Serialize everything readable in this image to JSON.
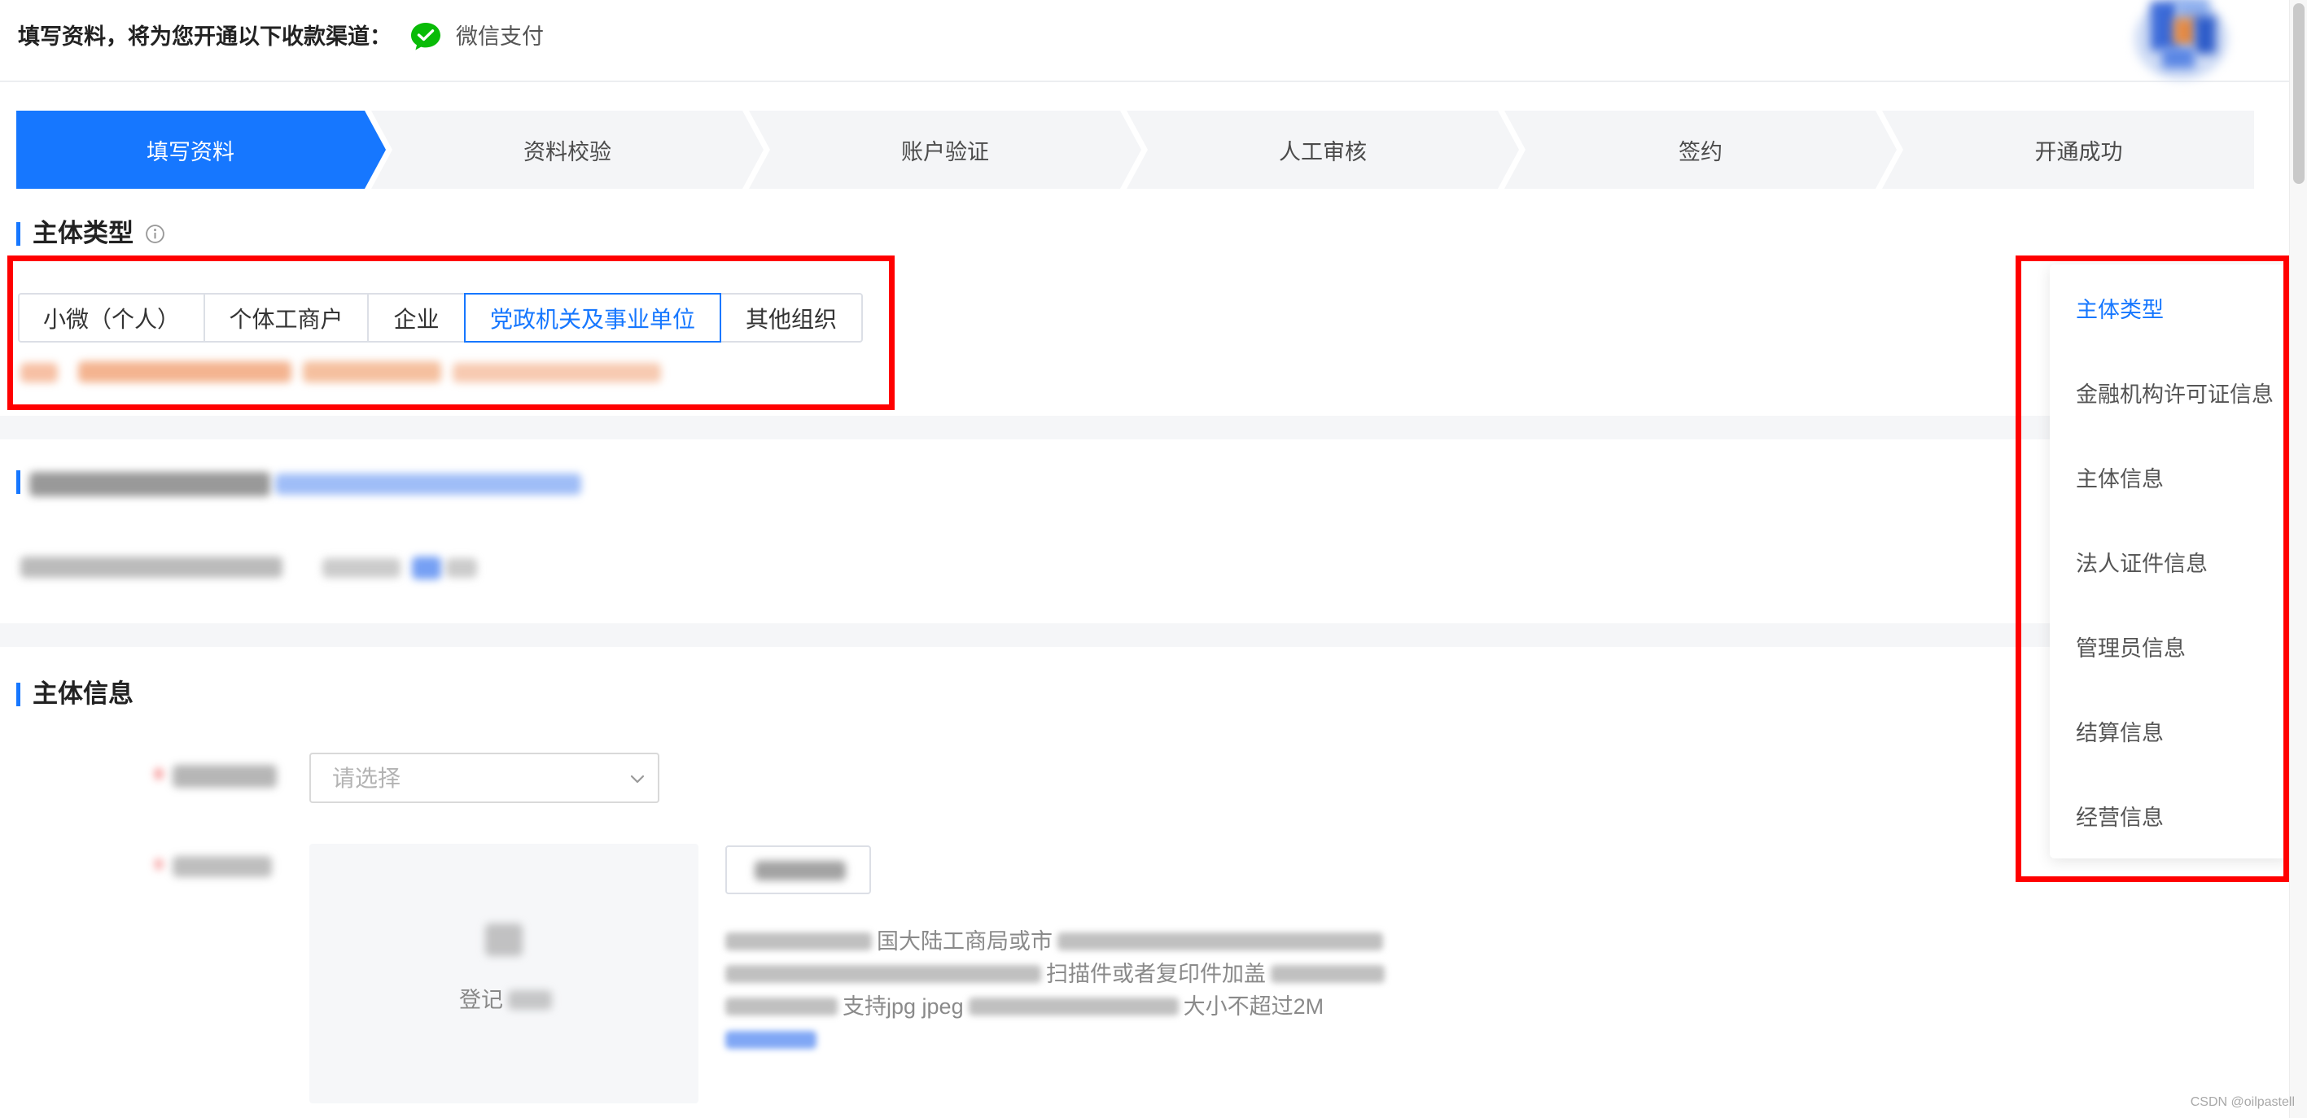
{
  "header": {
    "title": "填写资料，将为您开通以下收款渠道：",
    "channel": {
      "icon": "wechat-pay-icon",
      "label": "微信支付",
      "color": "#09bb07"
    }
  },
  "steps": [
    {
      "label": "填写资料",
      "active": true
    },
    {
      "label": "资料校验",
      "active": false
    },
    {
      "label": "账户验证",
      "active": false
    },
    {
      "label": "人工审核",
      "active": false
    },
    {
      "label": "签约",
      "active": false
    },
    {
      "label": "开通成功",
      "active": false
    }
  ],
  "subject_type": {
    "title": "主体类型",
    "info_icon": "info-icon",
    "options": [
      {
        "label": "小微（个人）",
        "selected": false
      },
      {
        "label": "个体工商户",
        "selected": false
      },
      {
        "label": "企业",
        "selected": false
      },
      {
        "label": "党政机关及事业单位",
        "selected": true
      },
      {
        "label": "其他组织",
        "selected": false
      }
    ]
  },
  "subject_info": {
    "title": "主体信息",
    "type_select": {
      "placeholder": "请选择",
      "icon": "chevron-down-icon"
    },
    "upload": {
      "hint": "登记",
      "icon": "upload-image-icon"
    },
    "description": {
      "line1": "国大陆工商局或市",
      "line2": "扫描件或者复印件加盖",
      "line3_a": "支持jpg jpeg",
      "line3_b": "大小不超过2M"
    }
  },
  "side_nav": {
    "items": [
      {
        "label": "主体类型",
        "active": true
      },
      {
        "label": "金融机构许可证信息",
        "active": false
      },
      {
        "label": "主体信息",
        "active": false
      },
      {
        "label": "法人证件信息",
        "active": false
      },
      {
        "label": "管理员信息",
        "active": false
      },
      {
        "label": "结算信息",
        "active": false
      },
      {
        "label": "经营信息",
        "active": false
      }
    ]
  },
  "watermark": "CSDN @oilpastell",
  "colors": {
    "primary": "#1677ff",
    "annotation_red": "#ff0000",
    "step_inactive": "#f4f5f7",
    "wechat_green": "#09bb07"
  }
}
